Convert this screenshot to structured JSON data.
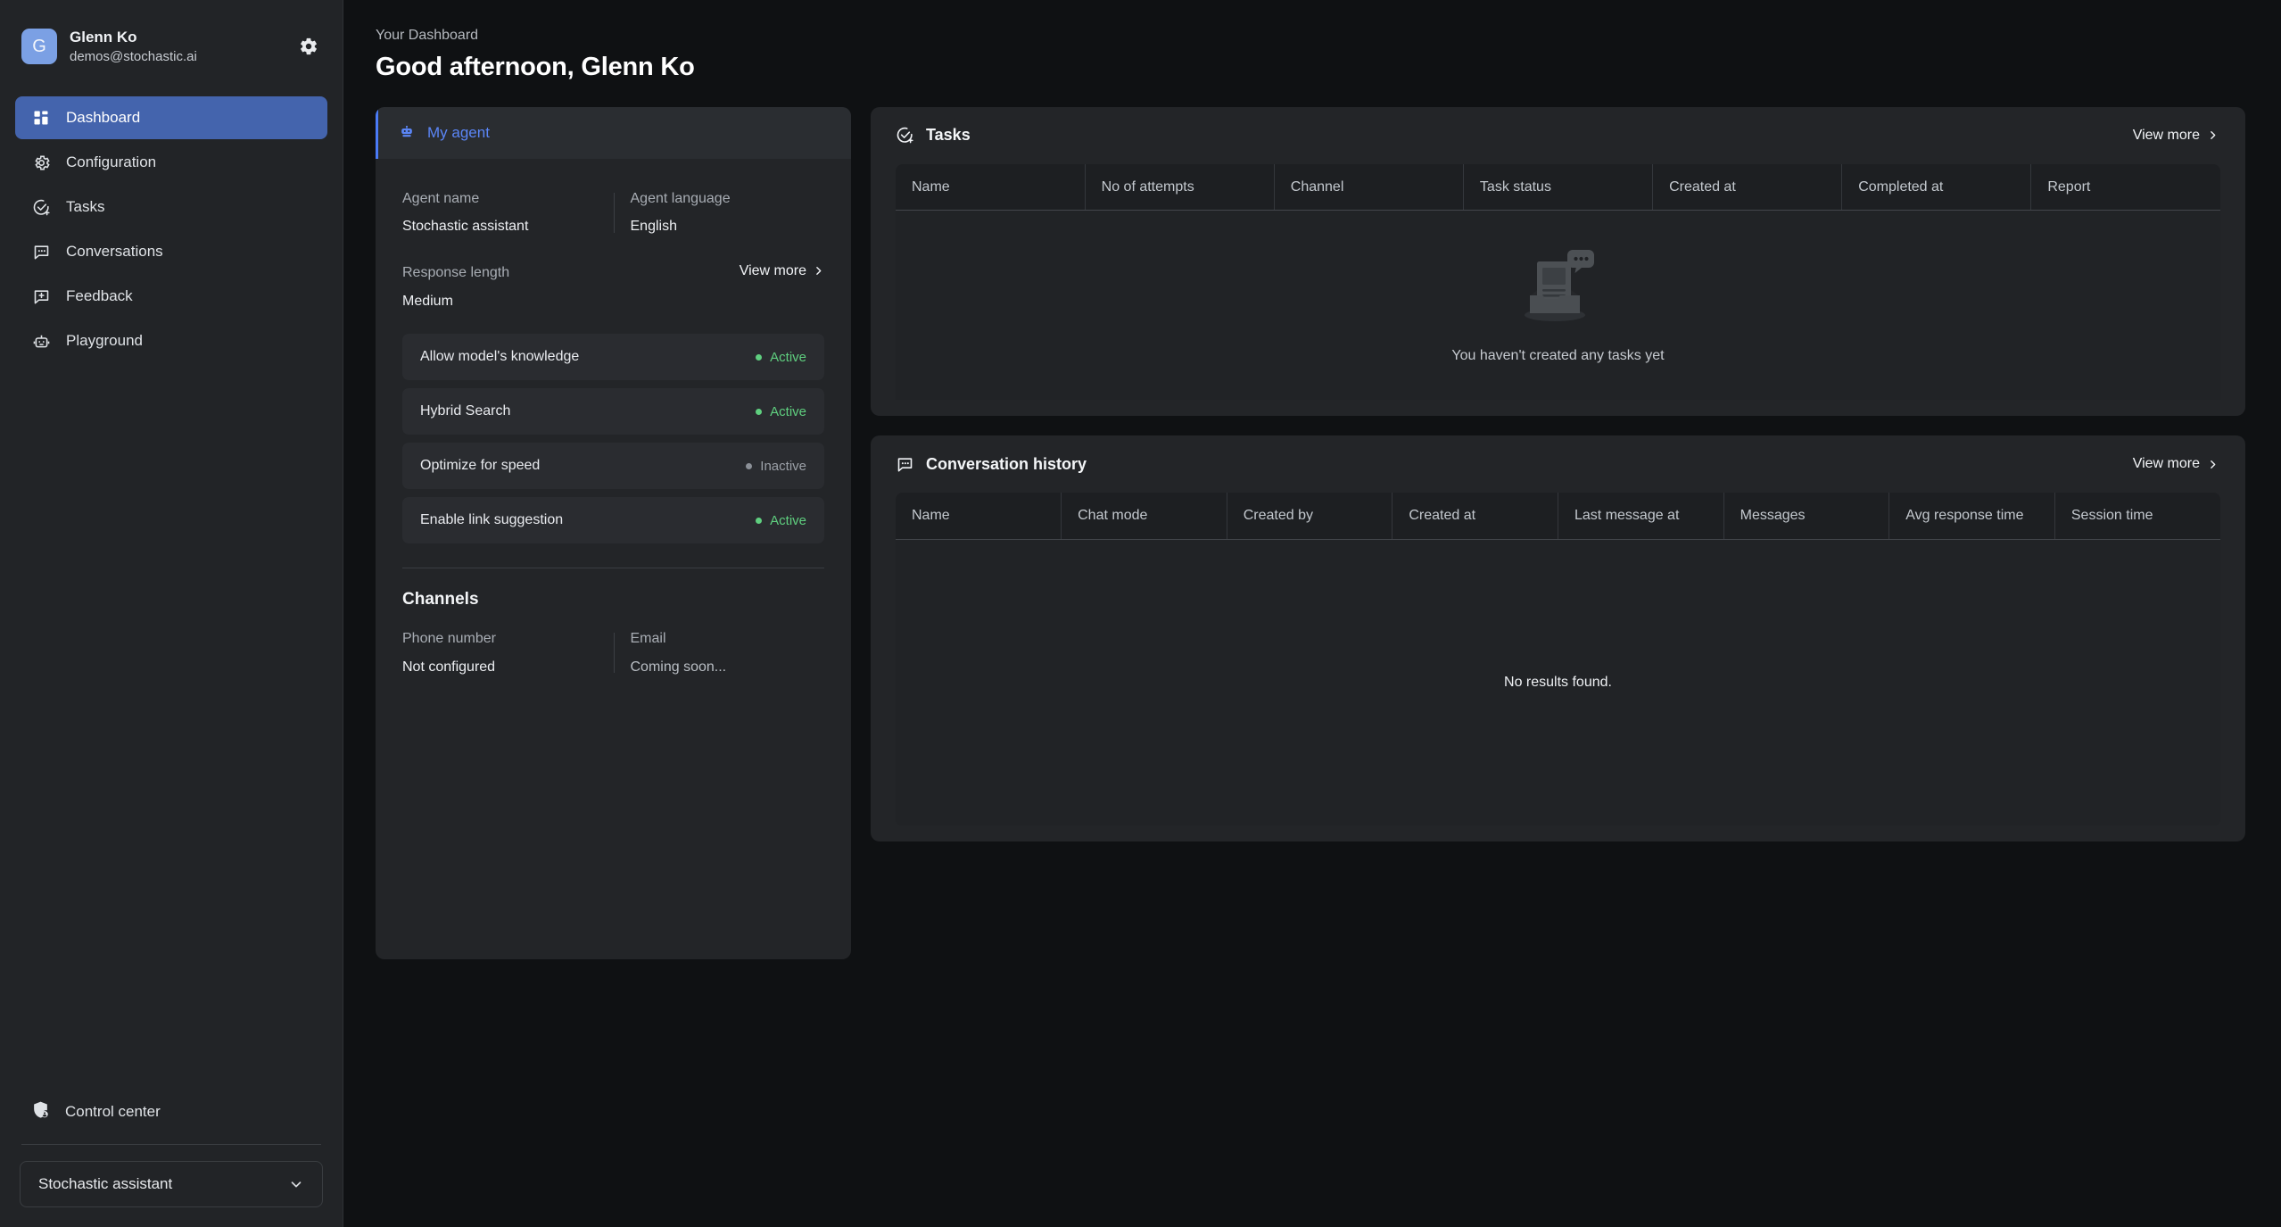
{
  "sidebar": {
    "user": {
      "name": "Glenn Ko",
      "email": "demos@stochastic.ai",
      "avatar_initial": "G"
    },
    "settings_icon": "gear-icon",
    "items": [
      {
        "label": "Dashboard",
        "icon": "dashboard-icon",
        "active": true
      },
      {
        "label": "Configuration",
        "icon": "gear-icon",
        "active": false
      },
      {
        "label": "Tasks",
        "icon": "check-circle-plus-icon",
        "active": false
      },
      {
        "label": "Conversations",
        "icon": "chat-dots-icon",
        "active": false
      },
      {
        "label": "Feedback",
        "icon": "chat-plus-icon",
        "active": false
      },
      {
        "label": "Playground",
        "icon": "robot-icon",
        "active": false
      }
    ],
    "control_center": {
      "label": "Control center",
      "icon": "shield-person-icon"
    },
    "agent_select": {
      "value": "Stochastic assistant",
      "icon": "chevron-down-icon"
    }
  },
  "header": {
    "breadcrumb": "Your Dashboard",
    "greeting": "Good afternoon, Glenn Ko"
  },
  "agent_card": {
    "tab": {
      "label": "My agent",
      "icon": "robot-icon"
    },
    "fields": [
      {
        "label": "Agent name",
        "value": "Stochastic assistant"
      },
      {
        "label": "Agent language",
        "value": "English"
      }
    ],
    "response_length": {
      "label": "Response length",
      "value": "Medium"
    },
    "view_more": "View more",
    "toggles": [
      {
        "name": "Allow model's knowledge",
        "status": "Active",
        "state": "active"
      },
      {
        "name": "Hybrid Search",
        "status": "Active",
        "state": "active"
      },
      {
        "name": "Optimize for speed",
        "status": "Inactive",
        "state": "inactive"
      },
      {
        "name": "Enable link suggestion",
        "status": "Active",
        "state": "active"
      }
    ],
    "channels": {
      "title": "Channels",
      "items": [
        {
          "label": "Phone number",
          "value": "Not configured"
        },
        {
          "label": "Email",
          "value": "Coming soon..."
        }
      ]
    }
  },
  "tasks_panel": {
    "title": "Tasks",
    "icon": "check-circle-plus-icon",
    "view_more": "View more",
    "columns": [
      "Name",
      "No of attempts",
      "Channel",
      "Task status",
      "Created at",
      "Completed at",
      "Report"
    ],
    "empty_text": "You haven't created any tasks yet",
    "rows": []
  },
  "conversation_panel": {
    "title": "Conversation history",
    "icon": "chat-dots-icon",
    "view_more": "View more",
    "columns": [
      "Name",
      "Chat mode",
      "Created by",
      "Created at",
      "Last message at",
      "Messages",
      "Avg response time",
      "Session time"
    ],
    "empty_text": "No results found.",
    "rows": []
  },
  "colors": {
    "page_bg": "#0f1113",
    "sidebar_bg": "#222427",
    "card_bg": "#232528",
    "accent_blue": "#4464ad",
    "link_blue": "#5b86f7",
    "active_green": "#5fcf7f",
    "inactive_gray": "#9ba0a7"
  }
}
